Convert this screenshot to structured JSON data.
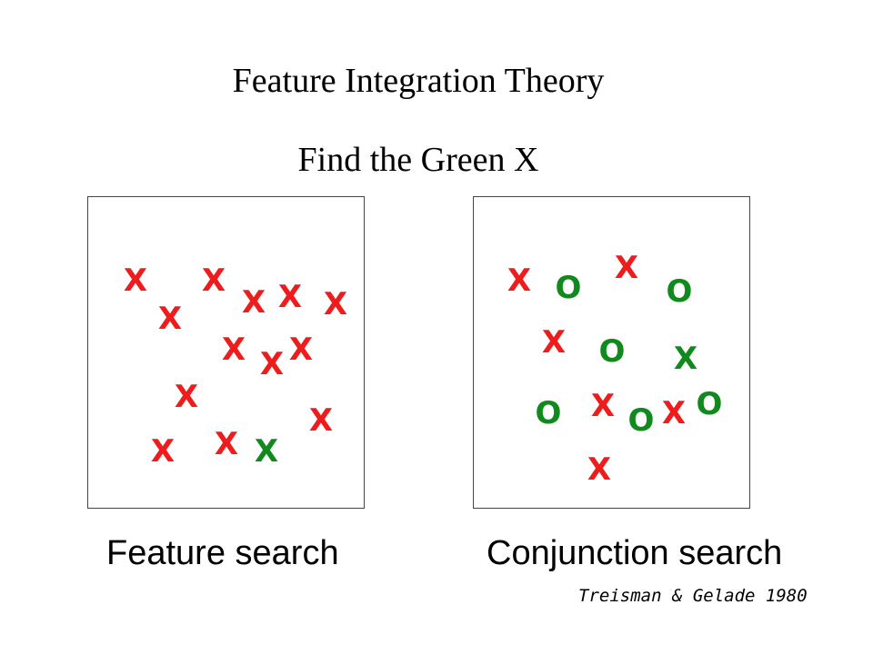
{
  "title": "Feature Integration Theory",
  "subtitle": "Find the Green X",
  "colors": {
    "red": "#ee1c1c",
    "green": "#118a1d"
  },
  "feature_search": {
    "caption": "Feature search",
    "items": [
      {
        "char": "X",
        "color": "red"
      },
      {
        "char": "X",
        "color": "red"
      },
      {
        "char": "X",
        "color": "red"
      },
      {
        "char": "X",
        "color": "red"
      },
      {
        "char": "X",
        "color": "red"
      },
      {
        "char": "X",
        "color": "red"
      },
      {
        "char": "X",
        "color": "red"
      },
      {
        "char": "X",
        "color": "red"
      },
      {
        "char": "X",
        "color": "red"
      },
      {
        "char": "X",
        "color": "red"
      },
      {
        "char": "X",
        "color": "red"
      },
      {
        "char": "X",
        "color": "red"
      },
      {
        "char": "X",
        "color": "red"
      },
      {
        "char": "X",
        "color": "green"
      }
    ]
  },
  "conjunction_search": {
    "caption": "Conjunction search",
    "items": [
      {
        "char": "X",
        "color": "red"
      },
      {
        "char": "O",
        "color": "green"
      },
      {
        "char": "X",
        "color": "red"
      },
      {
        "char": "O",
        "color": "green"
      },
      {
        "char": "X",
        "color": "red"
      },
      {
        "char": "O",
        "color": "green"
      },
      {
        "char": "X",
        "color": "green"
      },
      {
        "char": "O",
        "color": "green"
      },
      {
        "char": "X",
        "color": "red"
      },
      {
        "char": "O",
        "color": "green"
      },
      {
        "char": "X",
        "color": "red"
      },
      {
        "char": "O",
        "color": "green"
      },
      {
        "char": "X",
        "color": "red"
      }
    ]
  },
  "citation": "Treisman & Gelade 1980"
}
